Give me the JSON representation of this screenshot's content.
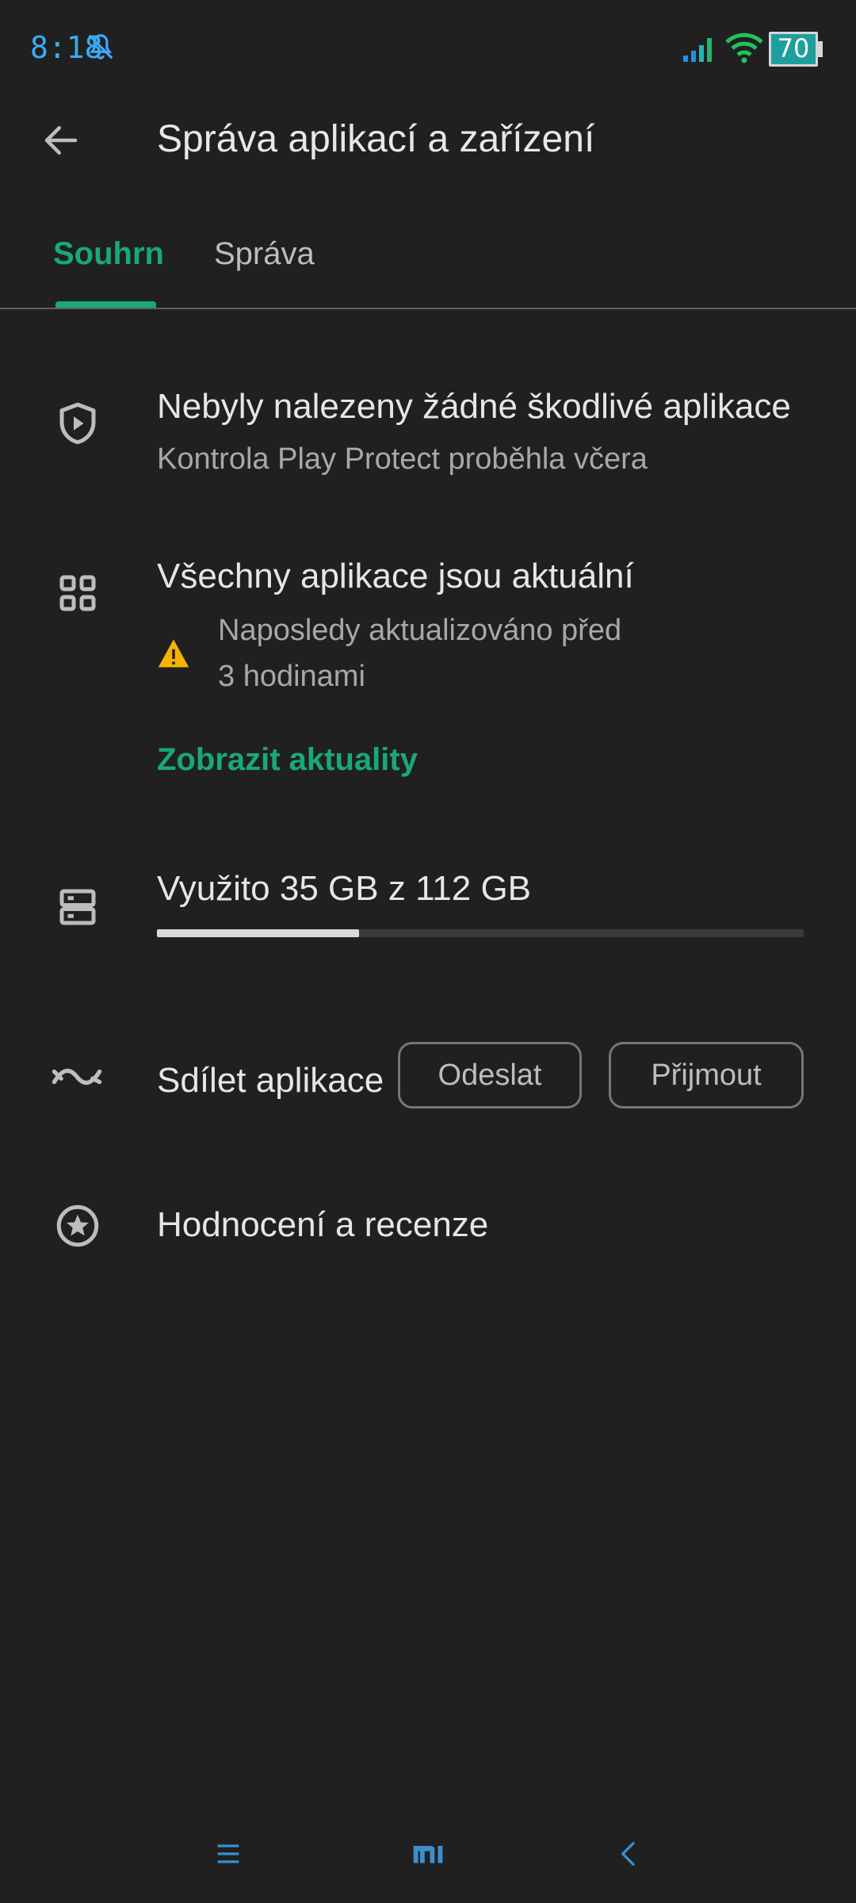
{
  "status_bar": {
    "time": "8:18",
    "battery": "70"
  },
  "header": {
    "title": "Správa aplikací a zařízení"
  },
  "tabs": [
    {
      "label": "Souhrn",
      "selected": true
    },
    {
      "label": "Správa",
      "selected": false
    }
  ],
  "protect": {
    "title": "Nebyly nalezeny žádné škodlivé aplikace",
    "subtitle": "Kontrola Play Protect proběhla včera"
  },
  "updates": {
    "title": "Všechny aplikace jsou aktuální",
    "warning_line1": "Naposledy aktualizováno před",
    "warning_line2": "3 hodinami",
    "link": "Zobrazit aktuality"
  },
  "storage": {
    "label": "Využito 35 GB z 112 GB",
    "used_gb": 35,
    "total_gb": 112
  },
  "share": {
    "label": "Sdílet aplikace",
    "send_label": "Odeslat",
    "receive_label": "Přijmout"
  },
  "ratings": {
    "label": "Hodnocení a recenze"
  },
  "icons": {
    "back": "arrow-left-icon",
    "protect": "shield-play-icon",
    "apps": "apps-grid-icon",
    "warning": "warning-triangle-icon",
    "storage": "storage-icon",
    "share": "share-apps-icon",
    "ratings": "star-circle-icon"
  },
  "colors": {
    "background": "#202020",
    "accent": "#1aa974",
    "warning": "#f4b400",
    "status_blue": "#3da9f5"
  }
}
